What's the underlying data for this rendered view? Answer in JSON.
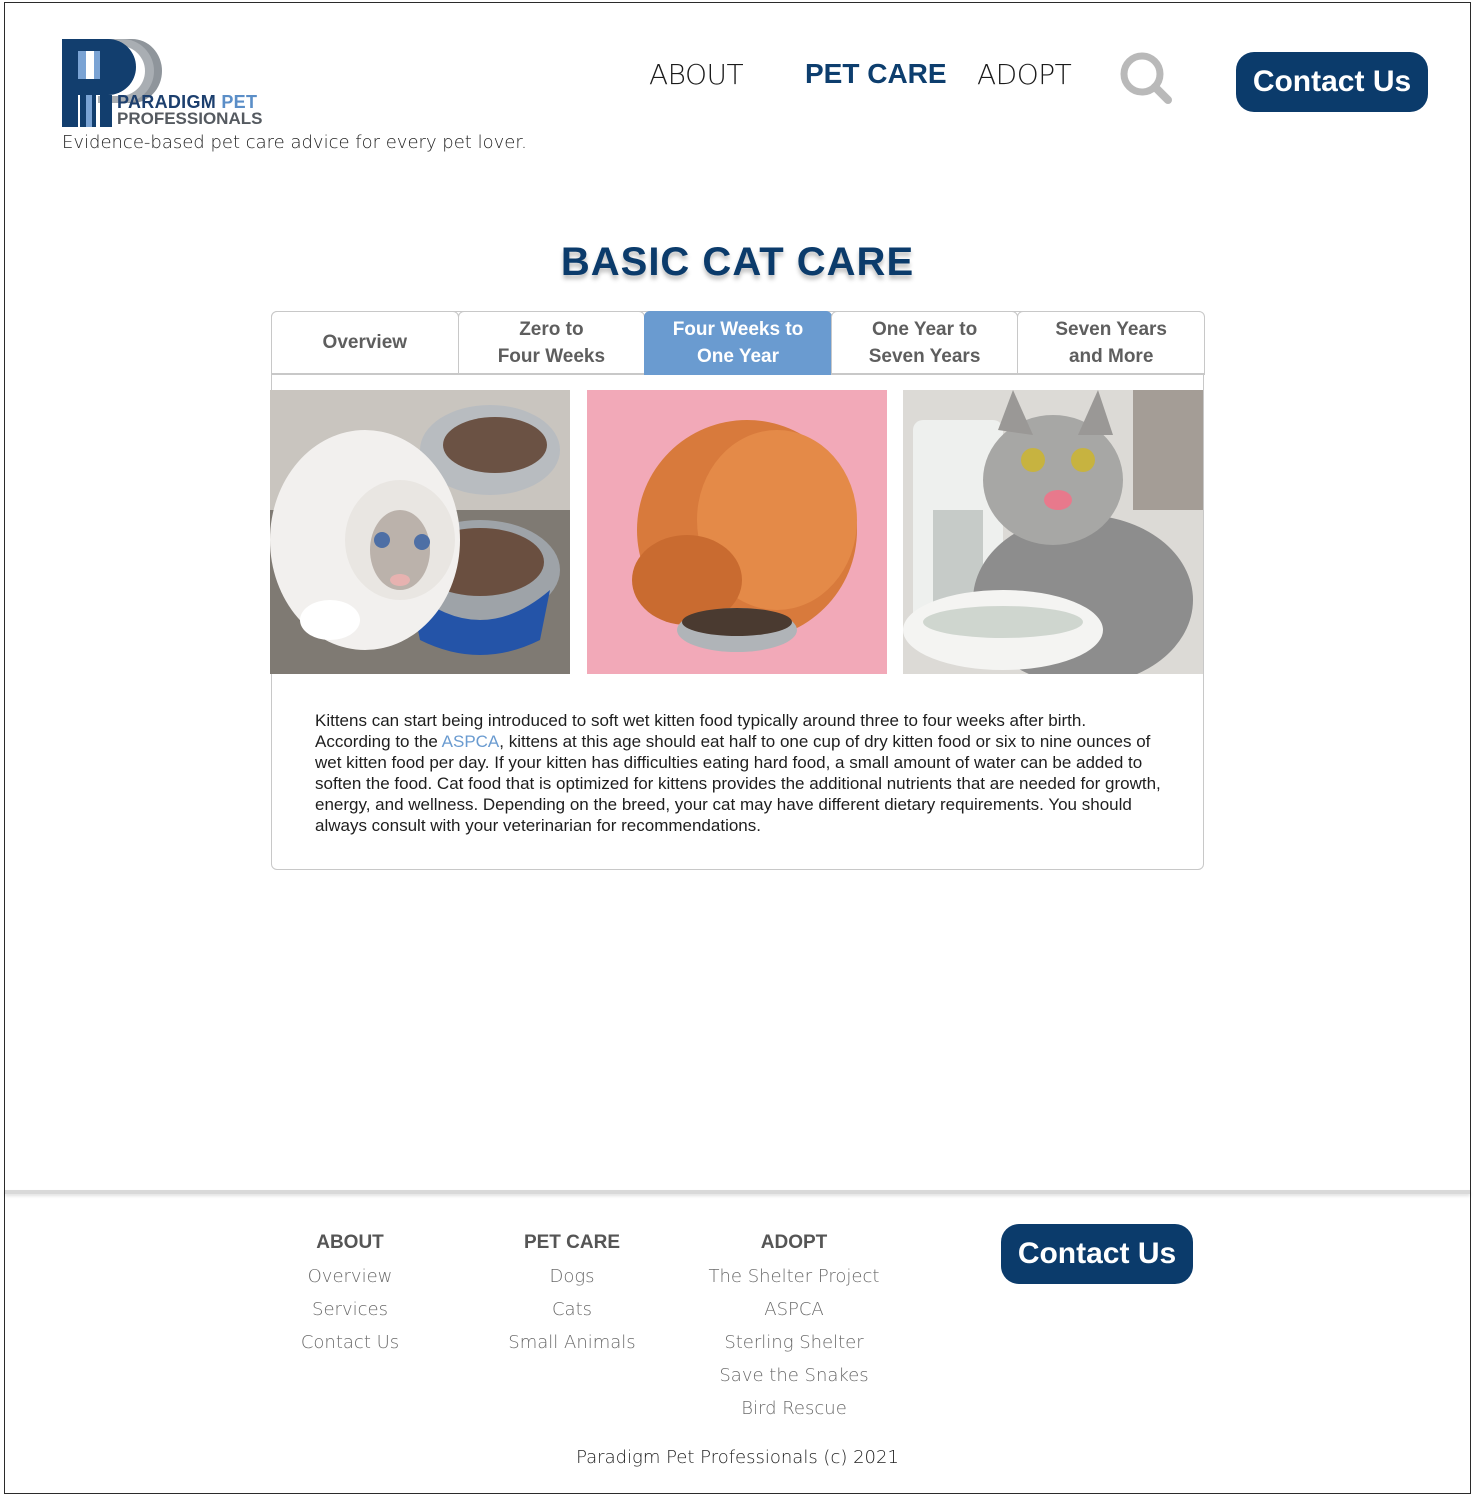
{
  "header": {
    "logo_line1": "PARADIGM",
    "logo_line1_accent": "PET",
    "logo_line2": "PROFESSIONALS",
    "tagline": "Evidence-based pet care advice for every pet lover.",
    "nav": {
      "about": "ABOUT",
      "pet_care": "PET CARE",
      "adopt": "ADOPT"
    },
    "contact_label": "Contact Us",
    "search_icon": "search-icon"
  },
  "main": {
    "title": "BASIC CAT CARE",
    "tabs": [
      {
        "label": "Overview",
        "active": false
      },
      {
        "label": "Zero to\nFour Weeks",
        "active": false
      },
      {
        "label": "Four Weeks to\nOne Year",
        "active": true
      },
      {
        "label": "One Year to\nSeven Years",
        "active": false
      },
      {
        "label": "Seven Years\nand More",
        "active": false
      }
    ],
    "text_before_link": "Kittens can start being introduced to soft wet kitten food typically around three to four weeks after birth. According to the ",
    "link_text": "ASPCA",
    "text_after_link": ", kittens at this age should eat half to one cup of dry kitten food or six to nine ounces of wet kitten food per day. If your kitten has difficulties eating hard food, a small amount of water can be added to soften the food. Cat food that is optimized for kittens provides the additional nutrients that are needed for growth, energy, and wellness. Depending on the breed, your cat may have different dietary requirements. You should always consult with your veterinarian for recommendations."
  },
  "footer": {
    "columns": [
      {
        "heading": "ABOUT",
        "items": [
          "Overview",
          "Services",
          "Contact Us"
        ]
      },
      {
        "heading": "PET CARE",
        "items": [
          "Dogs",
          "Cats",
          "Small Animals"
        ]
      },
      {
        "heading": "ADOPT",
        "items": [
          "The Shelter Project",
          "ASPCA",
          "Sterling Shelter",
          "Save the Snakes",
          "Bird Rescue"
        ]
      }
    ],
    "contact_label": "Contact Us",
    "copyright": "Paradigm Pet Professionals (c) 2021"
  },
  "colors": {
    "brand_navy": "#0b3b6b",
    "tab_active": "#6a9bd0",
    "link": "#6a9bd0"
  }
}
